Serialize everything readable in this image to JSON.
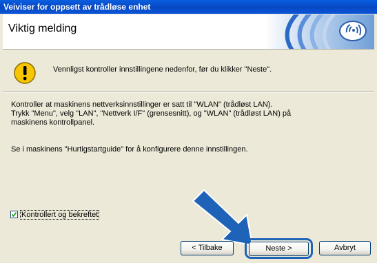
{
  "window": {
    "title": "Veiviser for oppsett av trådløse enhet"
  },
  "banner": {
    "heading": "Viktig melding"
  },
  "warning": {
    "message": "Vennligst kontroller innstillingene nedenfor, før du klikker \"Neste\"."
  },
  "body": {
    "line1": "Kontroller at maskinens nettverksinnstillinger er satt til \"WLAN\" (trådløst LAN).",
    "line2": "Trykk \"Menu\", velg \"LAN\", \"Nettverk I/F\" (grensesnitt), og \"WLAN\" (trådløst LAN) på",
    "line3": "maskinens kontrollpanel.",
    "line4": "Se i maskinens \"Hurtigstartguide\" for å konfigurere denne innstillingen."
  },
  "checkbox": {
    "label": "Kontrollert og bekreftet",
    "checked": true
  },
  "buttons": {
    "back": "< Tilbake",
    "next": "Neste >",
    "cancel": "Avbryt"
  },
  "colors": {
    "titlebar": "#0748c2",
    "accent_blue": "#1f63b8",
    "dialog_bg": "#ece9d8"
  },
  "icons": {
    "warning": "warning-icon",
    "wireless_logo": "wireless-logo-icon",
    "arrow": "pointer-arrow-icon"
  }
}
